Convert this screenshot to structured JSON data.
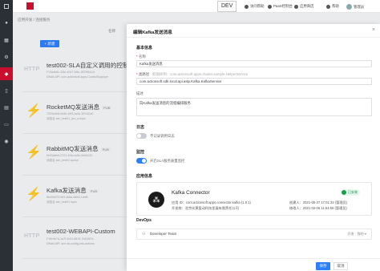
{
  "topbar": {
    "env": "DEV",
    "nav": [
      "访问帮助",
      "PaaS控制台",
      "应用商店",
      "帮助"
    ],
    "user": "管理员"
  },
  "sidebar": {
    "icons": [
      "pin-icon",
      "grid-icon",
      "settings-icon",
      "box-icon",
      "mobile-icon",
      "chart-icon",
      "doc-icon",
      "user-icon"
    ]
  },
  "breadcrumb": "应用开发 / 连接服务",
  "toolbar": {
    "new_label": "+ 新建"
  },
  "columns": {
    "name": "名称"
  },
  "list": [
    {
      "type": "http",
      "title": "test002-SLA自定义调用的控制器",
      "tag": "",
      "meta1": "F13a4b6c-1f3e-4047-bf4c-3879f81c1f",
      "meta2": "DNaN API: com.actionsoft.apps.ControlSupplyer"
    },
    {
      "type": "mq",
      "title": "RocketMQ发送消息",
      "tag": "PUB",
      "meta1": "7203a4b8-0d4b-49f3-bc3e-3f7c52a0",
      "meta2": "消息名 sim_test01_pro_a topic"
    },
    {
      "type": "mq",
      "title": "RabbitMQ发送消息",
      "tag": "PUB",
      "meta1": "5e03a6e6-2723-4f3a-bc5c-9e0d120",
      "meta2": "消息名 sim_test01 queue"
    },
    {
      "type": "mq",
      "title": "Kafka发送消息",
      "tag": "PUB",
      "meta1": "8b49d372-fdf3-4b8a-86b3-1dc8f",
      "meta2": "消息名 sim_test01 topic"
    },
    {
      "type": "http",
      "title": "test002-WEBAPI-Custom",
      "tag": "",
      "meta1": "F16c4b7d-1a7f-4d11-8819-7b518f7a",
      "meta2": "DNaN API: ann ds-config-info-actions"
    }
  ],
  "panel": {
    "title": "编辑Kafka发送消息",
    "close": "×",
    "basic_section": "基本信息",
    "name_label": "名称",
    "name_value": "Kafka发送消息",
    "class_label": "类路径",
    "class_hint": "取值样例：com.actionsoft.apps.cluster.sample.HelperService",
    "class_value": "com.actionsoft.sdk.local.api.aslp.Kafka.KafkaService",
    "desc_label": "描述",
    "desc_value": "向Kafka发送消息的流程编排服务",
    "log_section": "日志",
    "log_toggle_text": "不记录调用日志",
    "monitor_section": "监控",
    "monitor_toggle_text": "开启SLA服务质量监控",
    "app_section": "应用信息",
    "app_name": "Kafka Connector",
    "app_badge": "已安装",
    "app_id_label": "应用 ID：",
    "app_id_value": "com.actionsoft.apps.connector.kafka (1.0.1)",
    "app_dev_label": "开发商：",
    "app_dev_value": "北京炎黄盈动科技发展有限责任公司",
    "created_label": "创建人：",
    "created_value": "2021-05-27 17:01:32 (管理员)",
    "updated_label": "修改人：",
    "updated_value": "2021-02-06 11:54:55 (管理员)",
    "devops_section": "DevOps",
    "devops_team": "Developer Team",
    "devops_right": "开发 : 我的 ▾",
    "save_label": "保存",
    "cancel_label": "取消"
  },
  "colors": {
    "accent": "#2d7ff9",
    "brand": "#c8102e",
    "sidebar": "#2b2f36"
  }
}
